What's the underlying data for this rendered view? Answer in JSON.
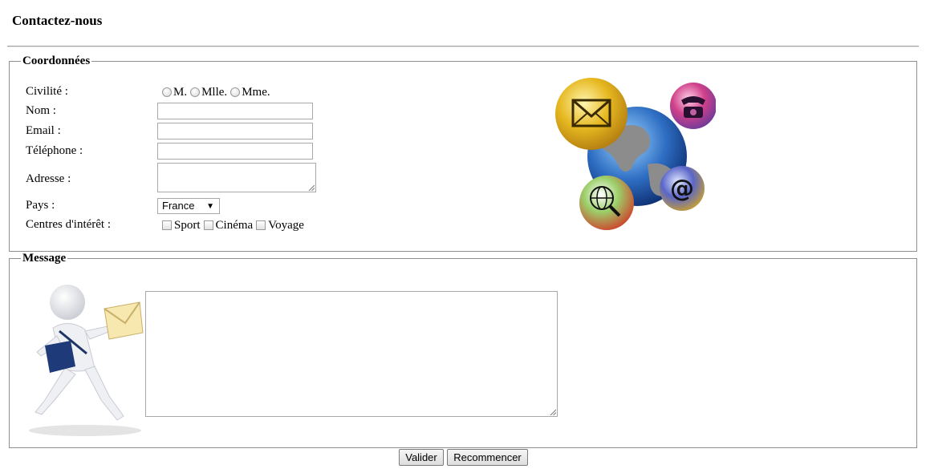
{
  "page": {
    "title": "Contactez-nous"
  },
  "coordonnees": {
    "legend": "Coordonnées",
    "civilite": {
      "label": "Civilité :",
      "options": [
        "M.",
        "Mlle.",
        "Mme."
      ]
    },
    "nom": {
      "label": "Nom :",
      "value": ""
    },
    "email": {
      "label": "Email :",
      "value": ""
    },
    "telephone": {
      "label": "Téléphone :",
      "value": ""
    },
    "adresse": {
      "label": "Adresse :",
      "value": ""
    },
    "pays": {
      "label": "Pays :",
      "selected": "France"
    },
    "interets": {
      "label": "Centres d'intérêt :",
      "options": [
        "Sport",
        "Cinéma",
        "Voyage"
      ]
    }
  },
  "message": {
    "legend": "Message",
    "value": ""
  },
  "buttons": {
    "submit": "Valider",
    "reset": "Recommencer"
  },
  "icons": [
    "envelope-bubble-icon",
    "telephone-bubble-icon",
    "globe-icon",
    "at-sign-bubble-icon",
    "web-search-bubble-icon",
    "running-mail-carrier-icon"
  ]
}
